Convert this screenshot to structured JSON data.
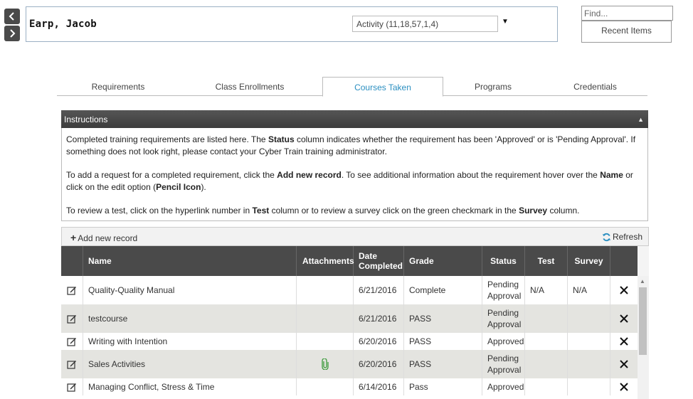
{
  "header": {
    "person_name": "Earp, Jacob",
    "activity_select": "Activity (11,18,57,1,4)",
    "find_placeholder": "Find...",
    "recent_items": "Recent Items"
  },
  "tabs": [
    {
      "label": "Requirements",
      "active": false
    },
    {
      "label": "Class Enrollments",
      "active": false
    },
    {
      "label": "Courses Taken",
      "active": true
    },
    {
      "label": "Programs",
      "active": false
    },
    {
      "label": "Credentials",
      "active": false
    }
  ],
  "instructions": {
    "title": "Instructions",
    "p1_a": "Completed training requirements are listed here.  The ",
    "p1_b": "Status",
    "p1_c": " column indicates whether the requirement has been 'Approved' or is 'Pending Approval'.  If something does not look right, please contact your Cyber Train training administrator.",
    "p2_a": "To add a request for a completed requirement, click the ",
    "p2_b": "Add new record",
    "p2_c": ".  To see additional information about the requirement hover over the ",
    "p2_d": "Name",
    "p2_e": " or click on the edit option (",
    "p2_f": "Pencil Icon",
    "p2_g": ").",
    "p3_a": "To review a test, click on the hyperlink number in ",
    "p3_b": "Test",
    "p3_c": " column or to review a survey click on the green checkmark in the ",
    "p3_d": "Survey",
    "p3_e": " column."
  },
  "toolbar": {
    "add_label": "Add new record",
    "refresh_label": "Refresh"
  },
  "grid": {
    "columns": {
      "name": "Name",
      "attachments": "Attachments",
      "date_completed": "Date Completed",
      "grade": "Grade",
      "status": "Status",
      "test": "Test",
      "survey": "Survey"
    },
    "rows": [
      {
        "name": "Quality-Quality Manual",
        "attachment": false,
        "date": "6/21/2016",
        "grade": "Complete",
        "status": "Pending Approval",
        "test": "N/A",
        "survey": "N/A"
      },
      {
        "name": "testcourse",
        "attachment": false,
        "date": "6/21/2016",
        "grade": "PASS",
        "status": "Pending Approval",
        "test": "",
        "survey": ""
      },
      {
        "name": "Writing with Intention",
        "attachment": false,
        "date": "6/20/2016",
        "grade": "PASS",
        "status": "Approved",
        "test": "",
        "survey": ""
      },
      {
        "name": "Sales Activities",
        "attachment": true,
        "date": "6/20/2016",
        "grade": "PASS",
        "status": "Pending Approval",
        "test": "",
        "survey": ""
      },
      {
        "name": "Managing Conflict, Stress & Time",
        "attachment": false,
        "date": "6/14/2016",
        "grade": "Pass",
        "status": "Approved",
        "test": "",
        "survey": ""
      }
    ]
  },
  "colors": {
    "accent": "#2b8fc1",
    "header_bg": "#4a4a4a",
    "alt_row": "#e4e4e0",
    "attachment_icon": "#3a9a3a"
  },
  "icons": {
    "edit": "pencil-icon",
    "delete": "close-icon",
    "attachment": "paperclip-icon",
    "refresh": "refresh-icon",
    "add": "plus-icon"
  }
}
